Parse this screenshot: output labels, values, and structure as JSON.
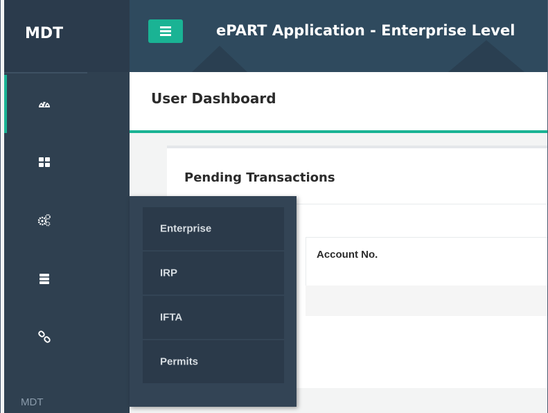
{
  "sidebar": {
    "brand": "MDT",
    "footer_label": "MDT",
    "items": [
      {
        "icon": "dashboard-icon",
        "active": true
      },
      {
        "icon": "grid-icon",
        "active": false
      },
      {
        "icon": "gears-icon",
        "active": false
      },
      {
        "icon": "server-icon",
        "active": false
      },
      {
        "icon": "link-icon",
        "active": false
      }
    ]
  },
  "topbar": {
    "menu_icon": "hamburger-icon",
    "app_title": "ePART Application - Enterprise Level"
  },
  "header": {
    "page_title": "User Dashboard"
  },
  "panel": {
    "title": "Pending Transactions",
    "columns": [
      "Account No."
    ]
  },
  "flyout": {
    "items": [
      "Enterprise",
      "IRP",
      "IFTA",
      "Permits"
    ]
  },
  "colors": {
    "accent": "#1ab394",
    "sidebar": "#2f4050",
    "flyout": "#334455"
  }
}
